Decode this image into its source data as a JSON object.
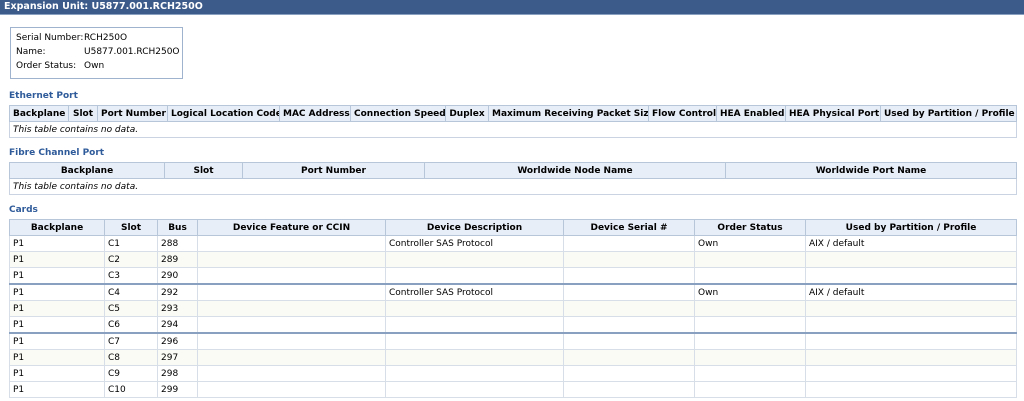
{
  "window": {
    "title": "Expansion Unit: U5877.001.RCH250O"
  },
  "summary": {
    "serial_label": "Serial Number:",
    "serial_value": "RCH250O",
    "name_label": "Name:",
    "name_value": "U5877.001.RCH250O",
    "order_label": "Order Status:",
    "order_value": "Own"
  },
  "ethernet": {
    "title": "Ethernet Port",
    "headers": [
      "Backplane",
      "Slot",
      "Port Number",
      "Logical Location Code",
      "MAC Address",
      "Connection Speed",
      "Duplex",
      "Maximum Receiving Packet Size",
      "Flow Control",
      "HEA Enabled",
      "HEA Physical Port",
      "Used by Partition / Profile"
    ],
    "empty": "This table contains no data."
  },
  "fibre": {
    "title": "Fibre Channel Port",
    "headers": [
      "Backplane",
      "Slot",
      "Port Number",
      "Worldwide Node Name",
      "Worldwide Port Name"
    ],
    "empty": "This table contains no data."
  },
  "cards": {
    "title": "Cards",
    "headers": [
      "Backplane",
      "Slot",
      "Bus",
      "Device Feature or CCIN",
      "Device Description",
      "Device Serial #",
      "Order Status",
      "Used by Partition / Profile"
    ],
    "rows": [
      [
        "P1",
        "C1",
        "288",
        "",
        "Controller SAS Protocol",
        "",
        "Own",
        "AIX / default"
      ],
      [
        "P1",
        "C2",
        "289",
        "",
        "",
        "",
        "",
        ""
      ],
      [
        "P1",
        "C3",
        "290",
        "",
        "",
        "",
        "",
        ""
      ],
      [
        "P1",
        "C4",
        "292",
        "",
        "Controller SAS Protocol",
        "",
        "Own",
        "AIX / default"
      ],
      [
        "P1",
        "C5",
        "293",
        "",
        "",
        "",
        "",
        ""
      ],
      [
        "P1",
        "C6",
        "294",
        "",
        "",
        "",
        "",
        ""
      ],
      [
        "P1",
        "C7",
        "296",
        "",
        "",
        "",
        "",
        ""
      ],
      [
        "P1",
        "C8",
        "297",
        "",
        "",
        "",
        "",
        ""
      ],
      [
        "P1",
        "C9",
        "298",
        "",
        "",
        "",
        "",
        ""
      ],
      [
        "P1",
        "C10",
        "299",
        "",
        "",
        "",
        "",
        ""
      ]
    ]
  }
}
